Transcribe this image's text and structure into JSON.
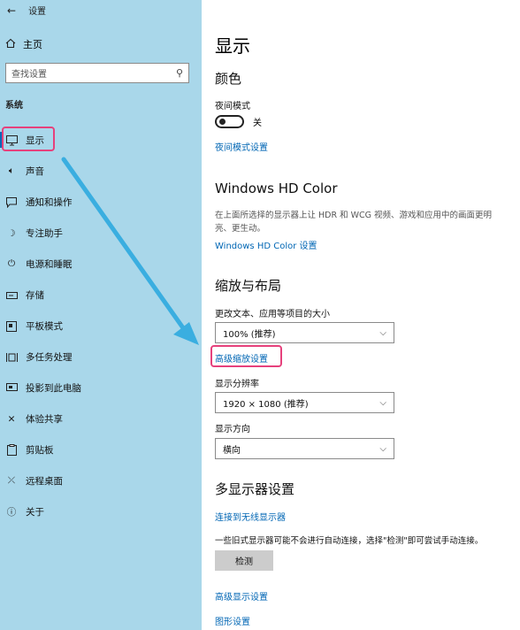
{
  "window": {
    "title": "设置"
  },
  "sidebar": {
    "home_label": "主页",
    "search_placeholder": "查找设置",
    "section_label": "系统",
    "items": [
      {
        "label": "显示",
        "icon": "monitor-icon",
        "active": true
      },
      {
        "label": "声音",
        "icon": "speaker-icon"
      },
      {
        "label": "通知和操作",
        "icon": "notification-icon"
      },
      {
        "label": "专注助手",
        "icon": "moon-icon"
      },
      {
        "label": "电源和睡眠",
        "icon": "power-icon"
      },
      {
        "label": "存储",
        "icon": "storage-icon"
      },
      {
        "label": "平板模式",
        "icon": "tablet-icon"
      },
      {
        "label": "多任务处理",
        "icon": "multitask-icon"
      },
      {
        "label": "投影到此电脑",
        "icon": "project-icon"
      },
      {
        "label": "体验共享",
        "icon": "share-icon"
      },
      {
        "label": "剪贴板",
        "icon": "clipboard-icon"
      },
      {
        "label": "远程桌面",
        "icon": "remote-icon"
      },
      {
        "label": "关于",
        "icon": "info-icon"
      }
    ]
  },
  "main": {
    "page_title": "显示",
    "color_section": {
      "heading": "颜色",
      "night_mode_label": "夜间模式",
      "night_mode_state": "关",
      "night_mode_settings_link": "夜间模式设置"
    },
    "hdr_section": {
      "heading": "Windows HD Color",
      "description": "在上面所选择的显示器上让 HDR 和 WCG 视频、游戏和应用中的画面更明亮、更生动。",
      "link": "Windows HD Color 设置"
    },
    "scale_section": {
      "heading": "缩放与布局",
      "scale_label": "更改文本、应用等项目的大小",
      "scale_value": "100% (推荐)",
      "advanced_scale_link": "高级缩放设置",
      "resolution_label": "显示分辨率",
      "resolution_value": "1920 × 1080 (推荐)",
      "orientation_label": "显示方向",
      "orientation_value": "横向"
    },
    "multi_display_section": {
      "heading": "多显示器设置",
      "wireless_link": "连接到无线显示器",
      "note": "一些旧式显示器可能不会进行自动连接，选择\"检测\"即可尝试手动连接。",
      "detect_button": "检测",
      "advanced_display_link": "高级显示设置",
      "graphics_link": "图形设置"
    }
  },
  "colors": {
    "sidebar_bg": "#a9d7ea",
    "accent": "#0066b4",
    "highlight": "#e6417c",
    "arrow": "#3aaee0"
  }
}
